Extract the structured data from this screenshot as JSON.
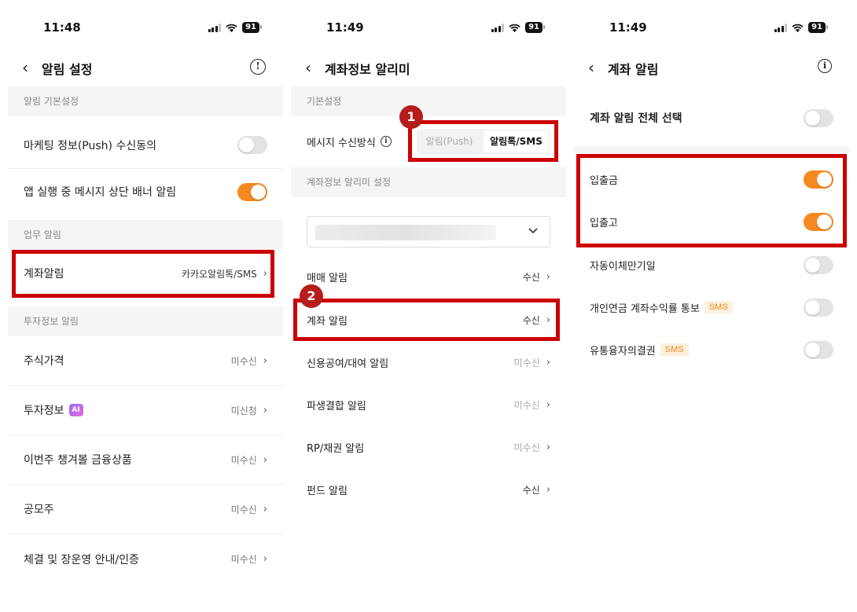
{
  "screen1": {
    "time": "11:48",
    "battery": "91",
    "title": "알림 설정",
    "sections": {
      "basic": "알림 기본설정",
      "work": "업무 알림",
      "invest": "투자정보 알림"
    },
    "marketing": "마케팅 정보(Push) 수신동의",
    "banner": "앱 실행 중 메시지 상단 배너 알림",
    "account_alert": {
      "label": "계좌알림",
      "value": "카카오알림톡/SMS"
    },
    "items": [
      {
        "label": "주식가격",
        "value": "미수신"
      },
      {
        "label": "투자정보",
        "value": "미신청",
        "badge": "AI"
      },
      {
        "label": "이번주 챙겨볼 금융상품",
        "value": "미수신"
      },
      {
        "label": "공모주",
        "value": "미수신"
      },
      {
        "label": "체결 및 장운영 안내/인증",
        "value": "미수신"
      }
    ]
  },
  "screen2": {
    "time": "11:49",
    "battery": "91",
    "title": "계좌정보 알리미",
    "section_basic": "기본설정",
    "receive_method": "메시지 수신방식",
    "seg_options": [
      "알림(Push)",
      "알림톡/SMS"
    ],
    "section_settings": "계좌정보 알리미 설정",
    "markers": [
      "1",
      "2"
    ],
    "rows": [
      {
        "label": "매매 알림",
        "value": "수신"
      },
      {
        "label": "계좌 알림",
        "value": "수신"
      },
      {
        "label": "신용공여/대여 알림",
        "value": "미수신"
      },
      {
        "label": "파생결합 알림",
        "value": "미수신"
      },
      {
        "label": "RP/채권 알림",
        "value": "미수신"
      },
      {
        "label": "펀드 알림",
        "value": "수신"
      }
    ]
  },
  "screen3": {
    "time": "11:49",
    "battery": "91",
    "title": "계좌 알림",
    "select_all": "계좌 알림 전체 선택",
    "rows": [
      {
        "label": "입출금",
        "on": true
      },
      {
        "label": "입출고",
        "on": true
      },
      {
        "label": "자동이체만기일",
        "on": false
      },
      {
        "label": "개인연금 계좌수익률 통보",
        "on": false,
        "badge": "SMS"
      },
      {
        "label": "유통융자의결권",
        "on": false,
        "badge": "SMS"
      }
    ]
  },
  "colors": {
    "accent": "#f5891f",
    "highlight": "#cc0000",
    "marker": "#b71c1c"
  }
}
